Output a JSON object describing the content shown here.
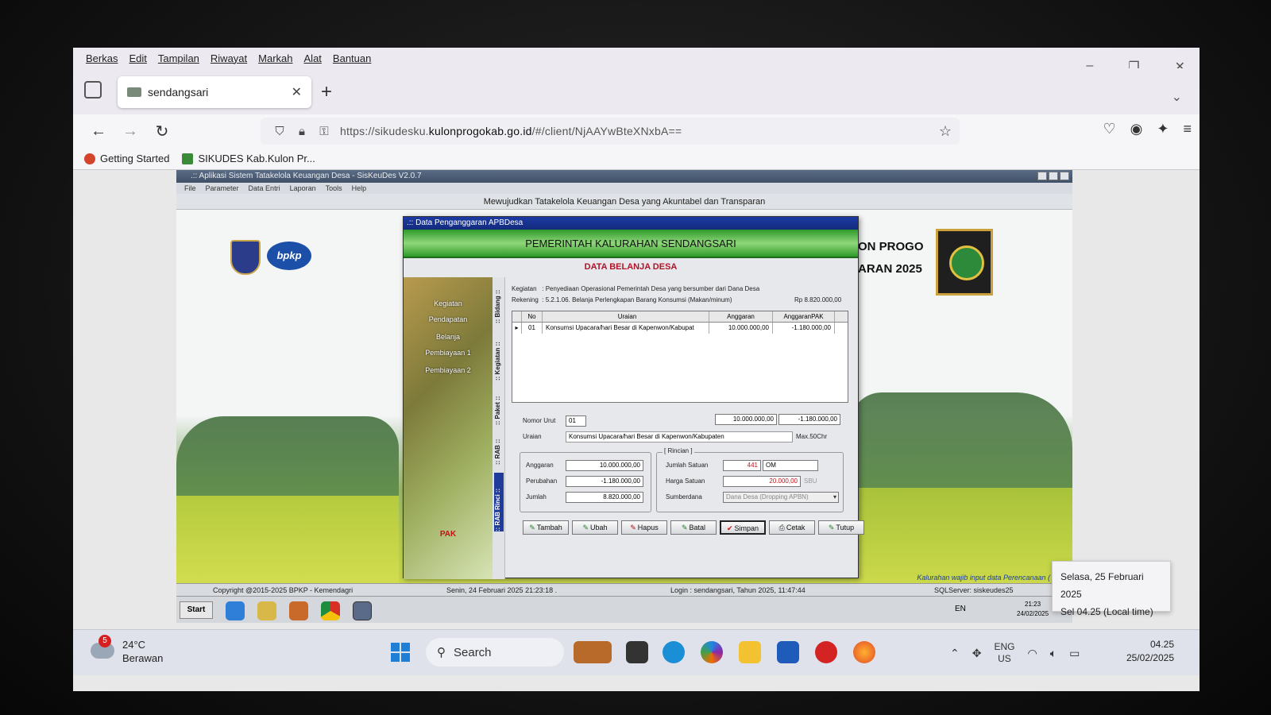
{
  "browser": {
    "menu": [
      "Berkas",
      "Edit",
      "Tampilan",
      "Riwayat",
      "Markah",
      "Alat",
      "Bantuan"
    ],
    "tab_title": "sendangsari",
    "url_prefix": "https://sikudesku.",
    "url_domain": "kulonprogokab.go.id",
    "url_suffix": "/#/client/NjAAYwBteXNxbA==",
    "bookmarks": [
      "Getting Started",
      "SIKUDES Kab.Kulon Pr..."
    ]
  },
  "app": {
    "title": ".:: Aplikasi Sistem Tatakelola Keuangan Desa - SisKeuDes V2.0.7",
    "menu": [
      "File",
      "Parameter",
      "Data Entri",
      "Laporan",
      "Tools",
      "Help"
    ],
    "slogan": "Mewujudkan Tatakelola Keuangan Desa yang Akuntabel dan Transparan",
    "bg_title_1": "ON PROGO",
    "bg_title_2": "ARAN 2025",
    "bpkp_logo_text": "bpkp",
    "notice": "Kalurahan wajib input data Perencanaan (",
    "status": {
      "copyright": "Copyright @2015-2025 BPKP - Kemendagri",
      "datetime": "Senin, 24 Februari 2025  21:23:18 .",
      "login": "Login : sendangsari,  Tahun 2025, 11:47:44",
      "server": "SQLServer: siskeudes25"
    },
    "xp_start": "Start",
    "xp_lang": "EN",
    "xp_clock_time": "21:23",
    "xp_clock_date": "24/02/2025"
  },
  "dialog": {
    "title": ".:: Data Penganggaran APBDesa",
    "header": "PEMERINTAH KALURAHAN SENDANGSARI",
    "subheader": "DATA BELANJA DESA",
    "side_menu": [
      "Kegiatan",
      "Pendapatan",
      "Belanja",
      "Pembiayaan 1",
      "Pembiayaan 2"
    ],
    "pak_label": "PAK",
    "vertical_tabs": [
      ":: Bidang ::",
      ":: Kegiatan ::",
      ":: Paket ::",
      ":: RAB ::",
      ":: RAB Rinci ::"
    ],
    "kegiatan_label": "Kegiatan",
    "kegiatan_value": ":  Penyediaan Operasional Pemerintah Desa yang bersumber dari Dana Desa",
    "rekening_label": "Rekening",
    "rekening_value": ":  5.2.1.06.  Belanja Perlengkapan Barang Konsumsi (Makan/minum)",
    "rekening_total": "Rp 8.820.000,00",
    "grid": {
      "headers": [
        "No",
        "Uraian",
        "Anggaran",
        "AnggaranPAK"
      ],
      "rows": [
        {
          "no": "01",
          "uraian": "Konsumsi Upacara/hari Besar di Kapenwon/Kabupat",
          "anggaran": "10.000.000,00",
          "anggaran_pak": "-1.180.000,00"
        }
      ]
    },
    "form": {
      "nomor_urut_label": "Nomor Urut",
      "nomor_urut": "01",
      "anggaran_top": "10.000.000,00",
      "pak_top": "-1.180.000,00",
      "uraian_label": "Uraian",
      "uraian": "Konsumsi Upacara/hari Besar di Kapenwon/Kabupaten",
      "max_chr": "Max.50Chr",
      "anggaran_label": "Anggaran",
      "anggaran": "10.000.000,00",
      "perubahan_label": "Perubahan",
      "perubahan": "-1.180.000,00",
      "jumlah_label": "Jumlah",
      "jumlah": "8.820.000,00",
      "rincian_label": "[ Rincian ]",
      "jumlah_satuan_label": "Jumlah Satuan",
      "jumlah_satuan": "441",
      "satuan": "OM",
      "harga_satuan_label": "Harga Satuan",
      "harga_satuan": "20.000,00",
      "sbu": "SBU",
      "sumberdana_label": "Sumberdana",
      "sumberdana": "Dana Desa (Dropping APBN)"
    },
    "buttons": [
      "Tambah",
      "Ubah",
      "Hapus",
      "Batal",
      "Simpan",
      "Cetak",
      "Tutup"
    ]
  },
  "taskbar": {
    "weather_badge": "5",
    "temperature": "24°C",
    "weather": "Berawan",
    "search": "Search",
    "lang_1": "ENG",
    "lang_2": "US",
    "time": "04.25",
    "date": "25/02/2025"
  },
  "tooltip": {
    "line1": "Selasa, 25 Februari 2025",
    "line2": "Sel 04.25 (Local time)"
  }
}
